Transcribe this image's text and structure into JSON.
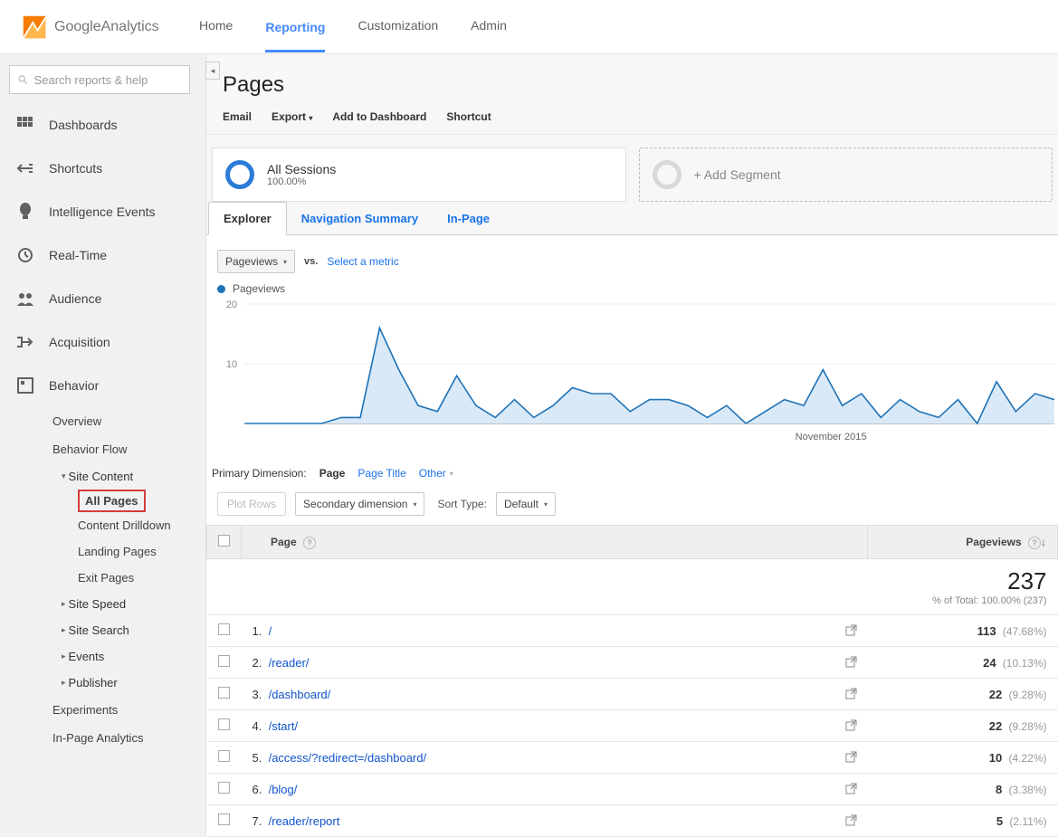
{
  "brand": {
    "name_prefix": "Google ",
    "name_bold": "Analytics"
  },
  "topnav": {
    "home": "Home",
    "reporting": "Reporting",
    "customization": "Customization",
    "admin": "Admin"
  },
  "search": {
    "placeholder": "Search reports & help"
  },
  "sidebar": {
    "dashboards": "Dashboards",
    "shortcuts": "Shortcuts",
    "intelligence": "Intelligence Events",
    "realtime": "Real-Time",
    "audience": "Audience",
    "acquisition": "Acquisition",
    "behavior": "Behavior",
    "behavior_sub": {
      "overview": "Overview",
      "flow": "Behavior Flow",
      "site_content": "Site Content",
      "site_content_items": {
        "all_pages": "All Pages",
        "drilldown": "Content Drilldown",
        "landing": "Landing Pages",
        "exit": "Exit Pages"
      },
      "site_speed": "Site Speed",
      "site_search": "Site Search",
      "events": "Events",
      "publisher": "Publisher",
      "experiments": "Experiments",
      "inpage": "In-Page Analytics"
    }
  },
  "page": {
    "title": "Pages"
  },
  "actions": {
    "email": "Email",
    "export": "Export",
    "add_dash": "Add to Dashboard",
    "shortcut": "Shortcut"
  },
  "segments": {
    "all_sessions": {
      "title": "All Sessions",
      "sub": "100.00%"
    },
    "add": "+ Add Segment"
  },
  "view_tabs": {
    "explorer": "Explorer",
    "nav_summary": "Navigation Summary",
    "in_page": "In-Page"
  },
  "chart_controls": {
    "metric": "Pageviews",
    "vs": "vs.",
    "select_metric": "Select a metric"
  },
  "legend": {
    "metric": "Pageviews"
  },
  "chart_data": {
    "type": "area",
    "ylabel": "Pageviews",
    "yticks": [
      10,
      20
    ],
    "ylim": [
      0,
      20
    ],
    "x_annotation": "November 2015",
    "values": [
      0,
      0,
      0,
      0,
      0,
      1,
      1,
      16,
      9,
      3,
      2,
      8,
      3,
      1,
      4,
      1,
      3,
      6,
      5,
      5,
      2,
      4,
      4,
      3,
      1,
      3,
      0,
      2,
      4,
      3,
      9,
      3,
      5,
      1,
      4,
      2,
      1,
      4,
      0,
      7,
      2,
      5,
      4
    ]
  },
  "dimension": {
    "label": "Primary Dimension:",
    "page": "Page",
    "page_title": "Page Title",
    "other": "Other"
  },
  "controls": {
    "plot_rows": "Plot Rows",
    "secondary_dim": "Secondary dimension",
    "sort_label": "Sort Type:",
    "sort_default": "Default"
  },
  "table": {
    "col_page": "Page",
    "col_pageviews": "Pageviews",
    "total_value": "237",
    "total_sub": "% of Total: 100.00% (237)",
    "rows": [
      {
        "rank": "1.",
        "path": "/",
        "pv": "113",
        "pct": "(47.68%)"
      },
      {
        "rank": "2.",
        "path": "/reader/",
        "pv": "24",
        "pct": "(10.13%)"
      },
      {
        "rank": "3.",
        "path": "/dashboard/",
        "pv": "22",
        "pct": "(9.28%)"
      },
      {
        "rank": "4.",
        "path": "/start/",
        "pv": "22",
        "pct": "(9.28%)"
      },
      {
        "rank": "5.",
        "path": "/access/?redirect=/dashboard/",
        "pv": "10",
        "pct": "(4.22%)"
      },
      {
        "rank": "6.",
        "path": "/blog/",
        "pv": "8",
        "pct": "(3.38%)"
      },
      {
        "rank": "7.",
        "path": "/reader/report",
        "pv": "5",
        "pct": "(2.11%)"
      }
    ]
  }
}
